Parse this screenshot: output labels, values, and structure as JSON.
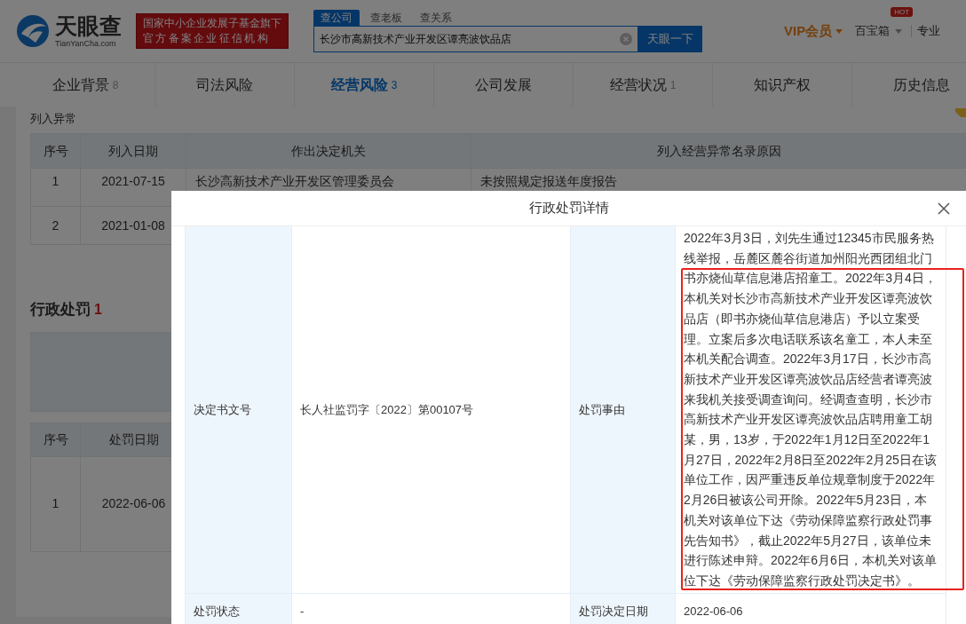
{
  "header": {
    "logo": {
      "name": "天眼查",
      "domain": "TianYanCha.com"
    },
    "badge_lines": [
      "国家中小企业发展子基金旗下",
      "官方备案企业征信机构"
    ],
    "search_tabs": [
      {
        "label": "查公司",
        "selected": true
      },
      {
        "label": "查老板",
        "selected": false
      },
      {
        "label": "查关系",
        "selected": false
      }
    ],
    "search": {
      "value": "长沙市高新技术产业开发区谭亮波饮品店"
    },
    "search_button": "天眼一下",
    "vip": "VIP会员",
    "toolbox": {
      "label": "百宝箱",
      "badge": "HOT"
    },
    "edge_link": "专业"
  },
  "nav_tabs": [
    {
      "label": "企业背景",
      "count": "8",
      "selected": false
    },
    {
      "label": "司法风险",
      "selected": false
    },
    {
      "label": "经营风险",
      "count": "3",
      "selected": true
    },
    {
      "label": "公司发展",
      "selected": false
    },
    {
      "label": "经营状况",
      "count": "1",
      "selected": false
    },
    {
      "label": "知识产权",
      "selected": false
    },
    {
      "label": "历史信息",
      "selected": false
    }
  ],
  "anomaly_section": {
    "title": "列入异常",
    "columns": [
      "序号",
      "列入日期",
      "作出决定机关",
      "列入经营异常名录原因"
    ],
    "rows": [
      [
        "1",
        "2021-07-15",
        "长沙高新技术产业开发区管理委员会",
        "未按照规定报送年度报告"
      ],
      [
        "2",
        "2021-01-08"
      ]
    ]
  },
  "penalty_section": {
    "title": "行政处罚",
    "count": "1",
    "columns": [
      "序号",
      "处罚日期"
    ],
    "rows": [
      [
        "1",
        "2022-06-06"
      ]
    ]
  },
  "modal": {
    "title": "行政处罚详情",
    "rows": [
      [
        {
          "label": "决定书文号",
          "value": "长人社监罚字〔2022〕第00107号"
        },
        {
          "label": "处罚事由",
          "value": "2022年3月3日，刘先生通过12345市民服务热线举报，岳麓区麓谷街道加州阳光西团组北门书亦烧仙草信息港店招童工。2022年3月4日，本机关对长沙市高新技术产业开发区谭亮波饮品店（即书亦烧仙草信息港店）予以立案受理。立案后多次电话联系该名童工，本人未至本机关配合调查。2022年3月17日，长沙市高新技术产业开发区谭亮波饮品店经营者谭亮波来我机关接受调查询问。经调查查明，长沙市高新技术产业开发区谭亮波饮品店聘用童工胡某，男，13岁，于2022年1月12日至2022年1月27日，2022年2月8日至2022年2月25日在该单位工作，因严重违反单位规章制度于2022年2月26日被该公司开除。2022年5月23日，本机关对该单位下达《劳动保障监察行政处罚事先告知书》，截止2022年5月27日，该单位未进行陈述申辩。2022年6月6日，本机关对该单位下达《劳动保障监察行政处罚决定书》。",
          "highlighted": true
        }
      ],
      [
        {
          "label": "处罚状态",
          "value": "-"
        },
        {
          "label": "处罚决定日期",
          "value": "2022-06-06"
        }
      ]
    ]
  }
}
